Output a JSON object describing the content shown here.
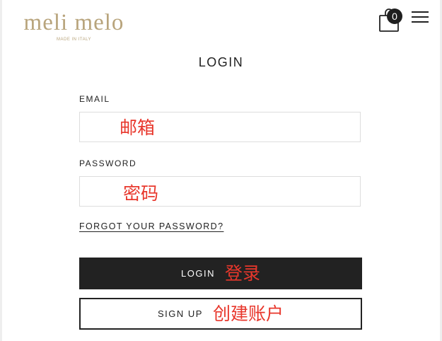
{
  "header": {
    "logo_text": "meli melo",
    "logo_tagline": "MADE IN ITALY",
    "cart_count": "0"
  },
  "login": {
    "title": "LOGIN",
    "email_label": "EMAIL",
    "email_value": "",
    "email_annotation": "邮箱",
    "password_label": "PASSWORD",
    "password_value": "",
    "password_annotation": "密码",
    "forgot_link": "FORGOT YOUR PASSWORD?",
    "login_button": "LOGIN",
    "login_annotation": "登录",
    "signup_button": "SIGN UP",
    "signup_annotation": "创建账户"
  },
  "colors": {
    "brand_gold": "#b8a47c",
    "button_dark": "#222222",
    "annotation_red": "#e8372c"
  },
  "icons": {
    "cart": "shopping-bag-icon",
    "menu": "hamburger-menu-icon"
  }
}
